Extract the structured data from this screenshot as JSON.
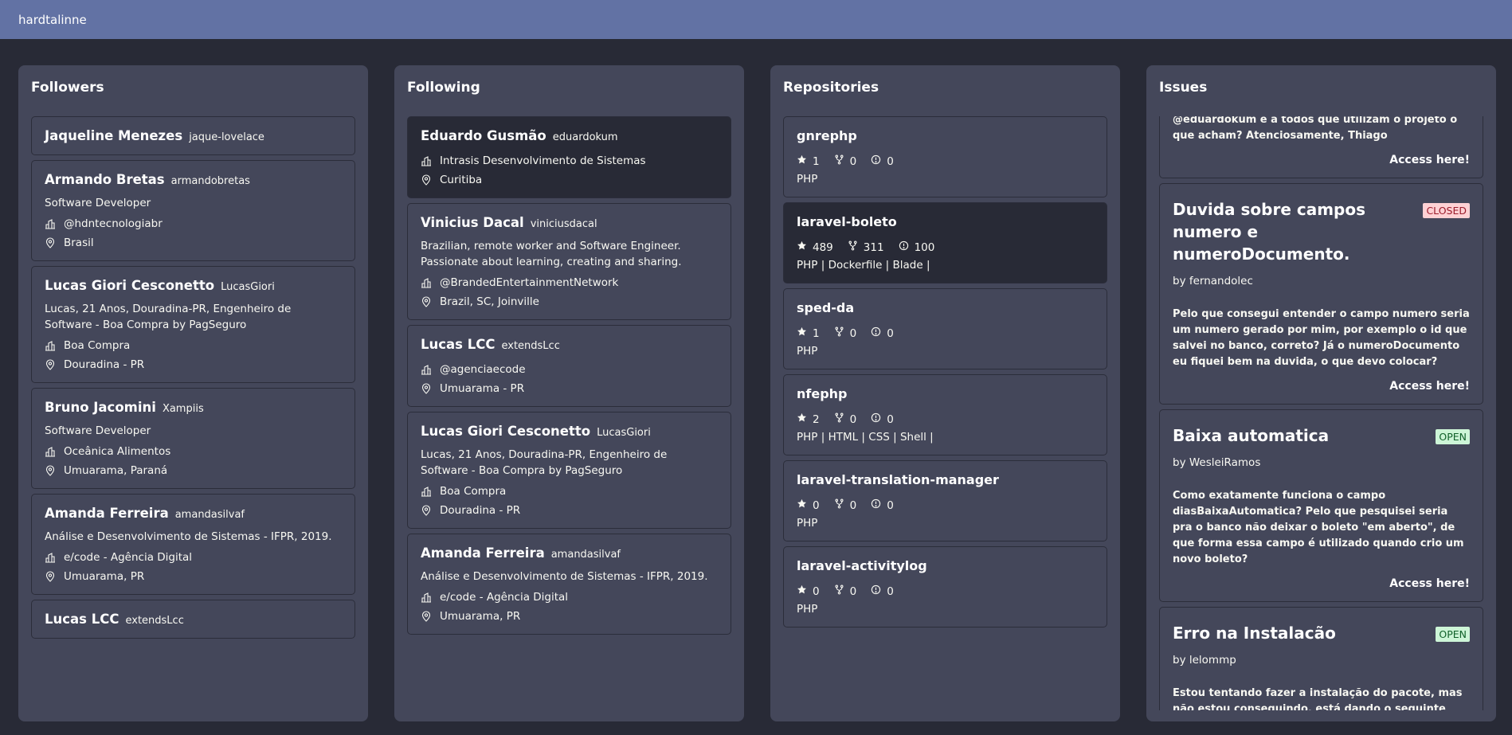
{
  "app": {
    "username": "hardtalinne"
  },
  "followers": {
    "title": "Followers",
    "items": [
      {
        "name": "Jaqueline Menezes",
        "login": "jaque-lovelace"
      },
      {
        "name": "Armando Bretas",
        "login": "armandobretas",
        "bio": "Software Developer",
        "company": "@hdntecnologiabr",
        "location": "Brasil"
      },
      {
        "name": "Lucas Giori Cesconetto",
        "login": "LucasGiori",
        "bio": "Lucas, 21 Anos, Douradina-PR, Engenheiro de Software - Boa Compra by PagSeguro",
        "company": "Boa Compra",
        "location": "Douradina - PR"
      },
      {
        "name": "Bruno Jacomini",
        "login": "Xampiis",
        "bio": "Software Developer",
        "company": "Oceânica Alimentos",
        "location": "Umuarama, Paraná"
      },
      {
        "name": "Amanda Ferreira",
        "login": "amandasilvaf",
        "bio": "Análise e Desenvolvimento de Sistemas - IFPR, 2019.",
        "company": "e/code - Agência Digital",
        "location": "Umuarama, PR"
      },
      {
        "name": "Lucas LCC",
        "login": "extendsLcc"
      }
    ]
  },
  "following": {
    "title": "Following",
    "items": [
      {
        "name": "Eduardo Gusmão",
        "login": "eduardokum",
        "company": "Intrasis Desenvolvimento de Sistemas",
        "location": "Curitiba"
      },
      {
        "name": "Vinicius Dacal",
        "login": "viniciusdacal",
        "bio": "Brazilian, remote worker and Software Engineer. Passionate about learning, creating and sharing.",
        "company": "@BrandedEntertainmentNetwork",
        "location": "Brazil, SC, Joinville"
      },
      {
        "name": "Lucas LCC",
        "login": "extendsLcc",
        "company": "@agenciaecode",
        "location": "Umuarama - PR"
      },
      {
        "name": "Lucas Giori Cesconetto",
        "login": "LucasGiori",
        "bio": "Lucas, 21 Anos, Douradina-PR, Engenheiro de Software - Boa Compra by PagSeguro",
        "company": "Boa Compra",
        "location": "Douradina - PR"
      },
      {
        "name": "Amanda Ferreira",
        "login": "amandasilvaf",
        "bio": "Análise e Desenvolvimento de Sistemas - IFPR, 2019.",
        "company": "e/code - Agência Digital",
        "location": "Umuarama, PR"
      }
    ]
  },
  "repositories": {
    "title": "Repositories",
    "items": [
      {
        "name": "gnrephp",
        "stars": "1",
        "forks": "0",
        "issues": "0",
        "langs": "PHP"
      },
      {
        "name": "laravel-boleto",
        "stars": "489",
        "forks": "311",
        "issues": "100",
        "langs": "PHP | Dockerfile | Blade |"
      },
      {
        "name": "sped-da",
        "stars": "1",
        "forks": "0",
        "issues": "0",
        "langs": "PHP"
      },
      {
        "name": "nfephp",
        "stars": "2",
        "forks": "0",
        "issues": "0",
        "langs": "PHP | HTML | CSS | Shell |"
      },
      {
        "name": "laravel-translation-manager",
        "stars": "0",
        "forks": "0",
        "issues": "0",
        "langs": "PHP"
      },
      {
        "name": "laravel-activitylog",
        "stars": "0",
        "forks": "0",
        "issues": "0",
        "langs": "PHP"
      }
    ]
  },
  "issues": {
    "title": "Issues",
    "link_label": "Access here!",
    "partial_body": "@eduardokum e a todos que utilizam o projeto o que acham? Atenciosamente, Thiago",
    "items": [
      {
        "title": "Duvida sobre campos numero e numeroDocumento.",
        "state": "CLOSED",
        "author": "by fernandolec",
        "body": "Pelo que consegui entender o campo numero seria um numero gerado por mim, por exemplo o id que salvei no banco, correto? Já o numeroDocumento eu fiquei bem na duvida, o que devo colocar?"
      },
      {
        "title": "Baixa automatica",
        "state": "OPEN",
        "author": "by WesleiRamos",
        "body": "Como exatamente funciona o campo diasBaixaAutomatica? Pelo que pesquisei seria pra o banco não deixar o boleto \"em aberto\", de que forma essa campo é utilizado quando crio um novo boleto?"
      },
      {
        "title": "Erro na Instalacão",
        "state": "OPEN",
        "author": "by lelommp",
        "body": "Estou tentando fazer a instalação do pacote, mas não estou conseguindo, está dando o seguinte problema:"
      }
    ]
  },
  "colors": {
    "background": "#282a36",
    "panel": "#44475a",
    "topbar": "#6272a4",
    "closed_badge": "#ffd1d4",
    "open_badge": "#cdf5d7"
  }
}
